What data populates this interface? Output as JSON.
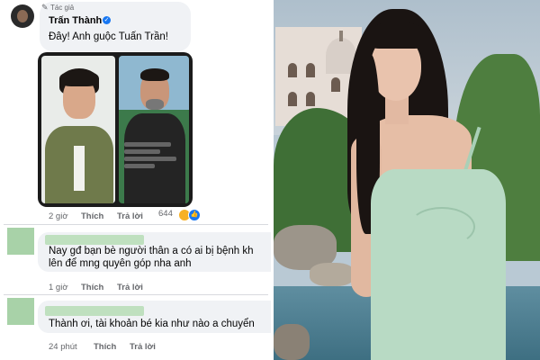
{
  "post": {
    "author_label": "Tác giả",
    "author_name": "Trấn Thành",
    "comment": "Đây! Anh guộc Tuấn Trần!",
    "time": "2 giờ",
    "like": "Thích",
    "reply": "Trả lời",
    "reaction_count": "644"
  },
  "comments": [
    {
      "line1": "Nay gđ bạn bè người thân a có ai bị bệnh kh",
      "line2": "lên để mng quyên góp nha anh",
      "time": "1 giờ",
      "like": "Thích",
      "reply": "Trả lời"
    },
    {
      "line1": "Thành ơi, tài khoản bé kia như nào a chuyển",
      "time": "24 phút",
      "like": "Thích",
      "reply": "Trả lời"
    }
  ],
  "colors": {
    "verified": "#1877f2",
    "meta_text": "#65676b",
    "bubble_bg": "#f0f2f5",
    "redacted_green": "#a8d2a8",
    "dress": "#b8dac4"
  },
  "icons": {
    "author_badge": "pen-icon",
    "verified": "verified-icon",
    "reaction_haha": "haha-icon",
    "reaction_like": "like-icon"
  }
}
